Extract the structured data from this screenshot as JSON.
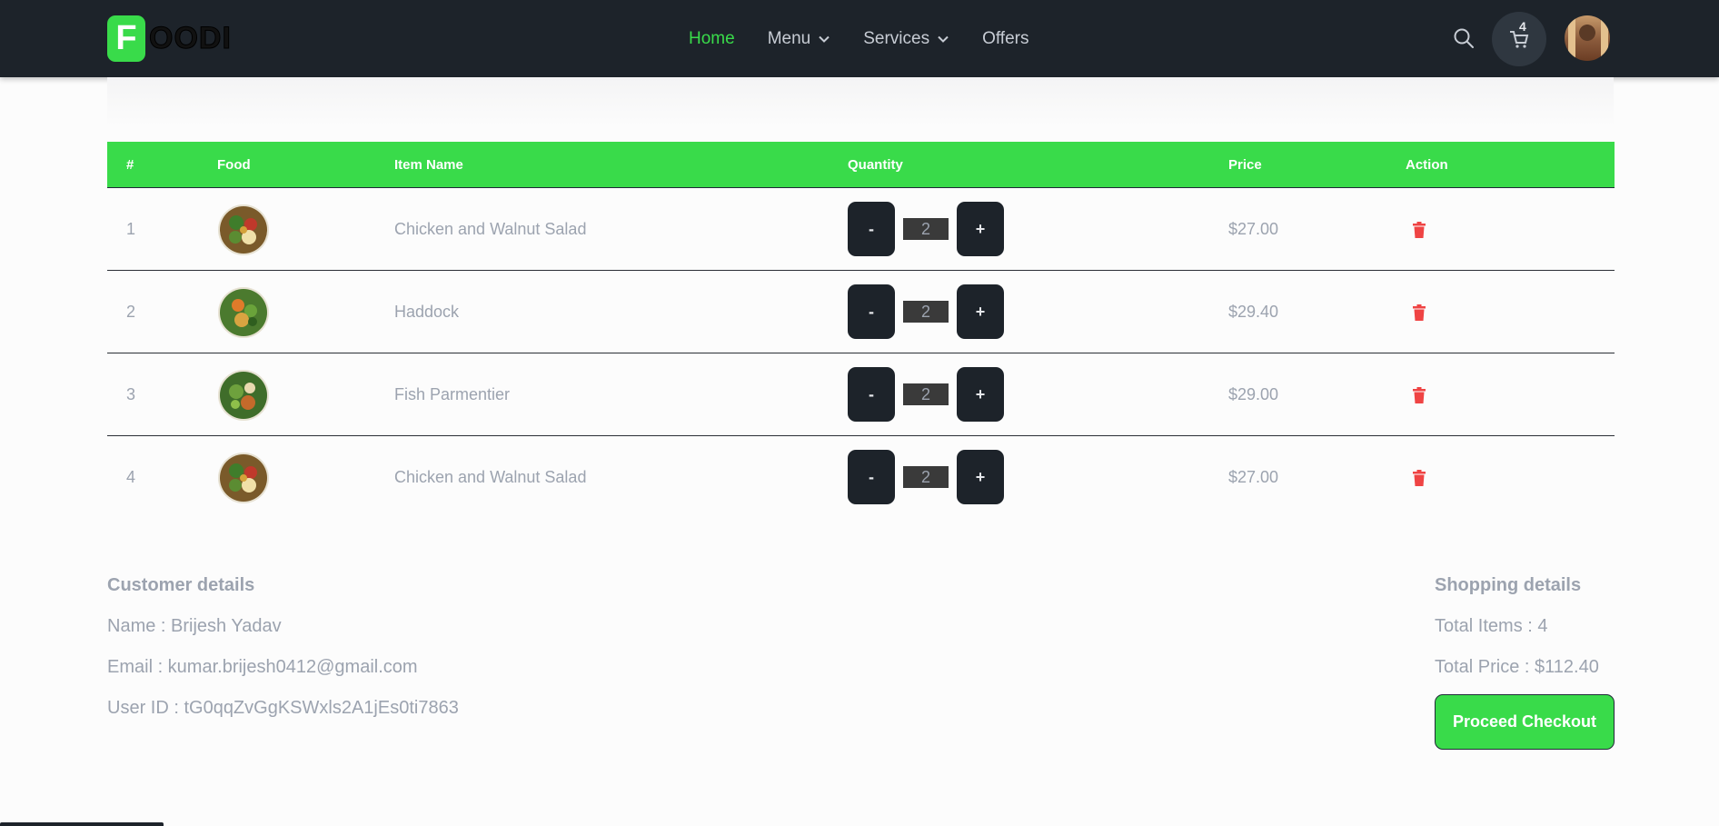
{
  "brand": {
    "logo_letter": "F",
    "logo_rest": "OODI",
    "accent": "#39db4a",
    "navbar_bg": "#1d232a"
  },
  "nav": {
    "items": [
      {
        "label": "Home",
        "active": true
      },
      {
        "label": "Menu",
        "dropdown": true
      },
      {
        "label": "Services",
        "dropdown": true
      },
      {
        "label": "Offers"
      }
    ],
    "cart_count": "4",
    "icons": [
      "search-icon",
      "cart-icon",
      "chevron-down-icon",
      "avatar"
    ]
  },
  "table": {
    "headers": [
      "#",
      "Food",
      "Item Name",
      "Quantity",
      "Price",
      "Action"
    ],
    "rows": [
      {
        "num": "1",
        "name": "Chicken and Walnut Salad",
        "qty": "2",
        "price": "$27.00"
      },
      {
        "num": "2",
        "name": "Haddock",
        "qty": "2",
        "price": "$29.40"
      },
      {
        "num": "3",
        "name": "Fish Parmentier",
        "qty": "2",
        "price": "$29.00"
      },
      {
        "num": "4",
        "name": "Chicken and Walnut Salad",
        "qty": "2",
        "price": "$27.00"
      }
    ],
    "minus_label": "-",
    "plus_label": "+"
  },
  "customer": {
    "title": "Customer details",
    "name": "Name : Brijesh Yadav",
    "email": "Email : kumar.brijesh0412@gmail.com",
    "user_id": "User ID : tG0qqZvGgKSWxls2A1jEs0ti7863"
  },
  "shopping": {
    "title": "Shopping details",
    "total_items": "Total Items : 4",
    "total_price": "Total Price : $112.40",
    "checkout_label": "Proceed Checkout"
  }
}
